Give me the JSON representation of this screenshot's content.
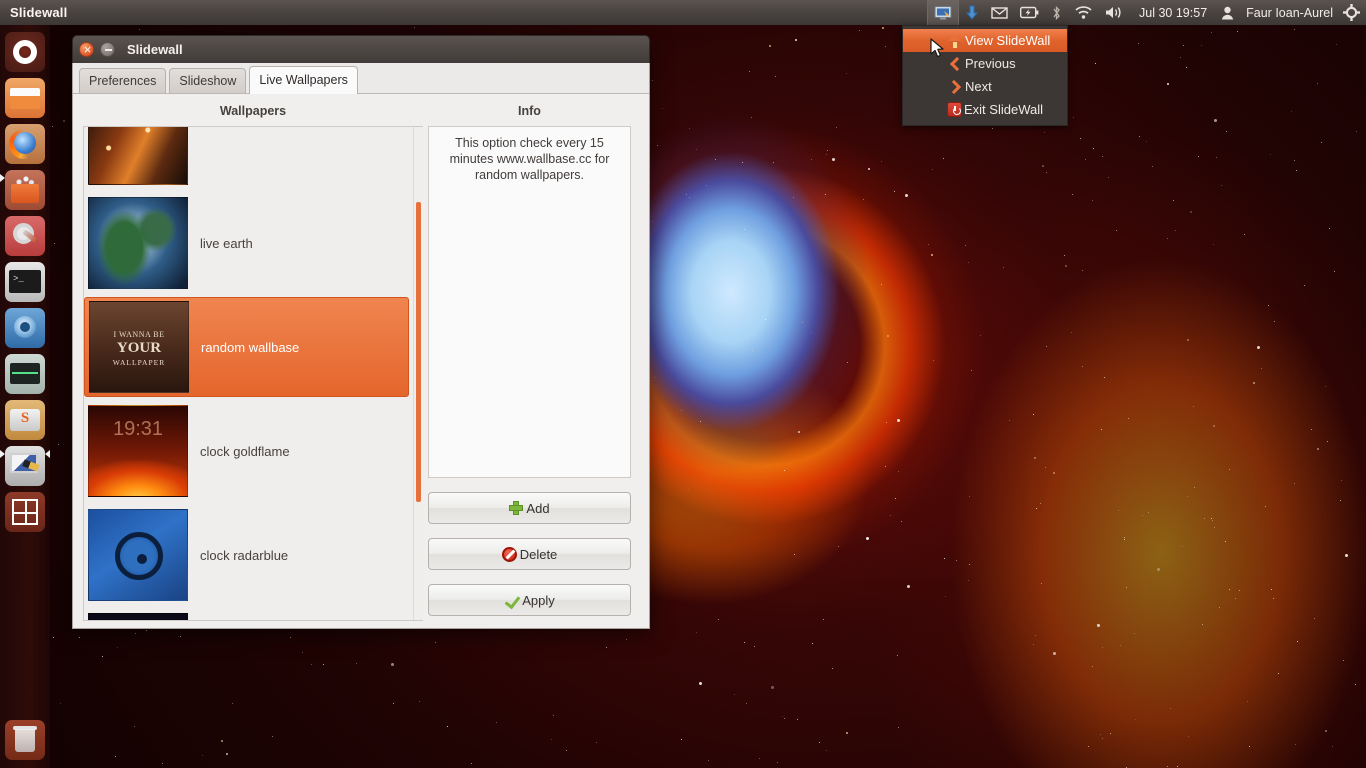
{
  "panel": {
    "app_title": "Slidewall",
    "clock": "Jul 30 19:57",
    "user": "Faur Ioan-Aurel",
    "icons": [
      {
        "name": "slidewall-indicator-icon",
        "glyph": "monitor"
      },
      {
        "name": "update-indicator-icon",
        "glyph": "download-arrow"
      },
      {
        "name": "messaging-indicator-icon",
        "glyph": "envelope"
      },
      {
        "name": "battery-indicator-icon",
        "glyph": "battery"
      },
      {
        "name": "bluetooth-indicator-icon",
        "glyph": "bluetooth"
      },
      {
        "name": "network-indicator-icon",
        "glyph": "wifi"
      },
      {
        "name": "sound-indicator-icon",
        "glyph": "speaker"
      }
    ],
    "session_icon": "gear-icon"
  },
  "indicator_menu": {
    "items": [
      {
        "label": "View SlideWall",
        "icon": "home-icon",
        "selected": true
      },
      {
        "label": "Previous",
        "icon": "chevron-left-icon",
        "selected": false
      },
      {
        "label": "Next",
        "icon": "chevron-right-icon",
        "selected": false
      },
      {
        "label": "Exit SlideWall",
        "icon": "power-icon",
        "selected": false
      }
    ]
  },
  "launcher": {
    "items": [
      {
        "name": "dash-home",
        "label": "Dash home"
      },
      {
        "name": "files",
        "label": "Files"
      },
      {
        "name": "firefox",
        "label": "Firefox"
      },
      {
        "name": "software-center",
        "label": "Ubuntu Software Center"
      },
      {
        "name": "system-settings",
        "label": "System Settings"
      },
      {
        "name": "terminal",
        "label": "Terminal"
      },
      {
        "name": "chromium",
        "label": "Chromium"
      },
      {
        "name": "system-monitor",
        "label": "System Monitor"
      },
      {
        "name": "s-drive",
        "label": "S"
      },
      {
        "name": "slidewall",
        "label": "Slidewall",
        "running": true,
        "focused": true
      },
      {
        "name": "workspace-switcher",
        "label": "Workspace Switcher"
      }
    ],
    "trash": {
      "name": "trash",
      "label": "Trash"
    }
  },
  "window": {
    "title": "Slidewall",
    "close_label": "×",
    "minimize_label": "−",
    "tabs": [
      {
        "label": "Preferences",
        "active": false
      },
      {
        "label": "Slideshow",
        "active": false
      },
      {
        "label": "Live Wallpapers",
        "active": true
      }
    ],
    "wallpapers_header": "Wallpapers",
    "info_header": "Info",
    "info_text": "This option check every 15 minutes www.wallbase.cc for random wallpapers.",
    "wallpapers": [
      {
        "name": "",
        "thumb": "city-traffic",
        "selected": false
      },
      {
        "name": "live earth",
        "thumb": "earth",
        "selected": false
      },
      {
        "name": "random wallbase",
        "thumb": "wallbase",
        "selected": true,
        "thumb_text": {
          "line1": "I WANNA BE",
          "line2": "YOUR",
          "line3": "WALLPAPER"
        }
      },
      {
        "name": "clock goldflame",
        "thumb": "goldflame",
        "selected": false,
        "thumb_clock": "19:31"
      },
      {
        "name": "clock radarblue",
        "thumb": "radarblue",
        "selected": false
      },
      {
        "name": "",
        "thumb": "dark",
        "selected": false
      }
    ],
    "buttons": [
      {
        "label": "Add",
        "icon": "plus-icon"
      },
      {
        "label": "Delete",
        "icon": "deny-icon"
      },
      {
        "label": "Apply",
        "icon": "check-icon"
      }
    ]
  },
  "colors": {
    "accent_orange": "#e4662c",
    "panel_bg": "#423c39",
    "menu_bg": "#3c3735"
  }
}
